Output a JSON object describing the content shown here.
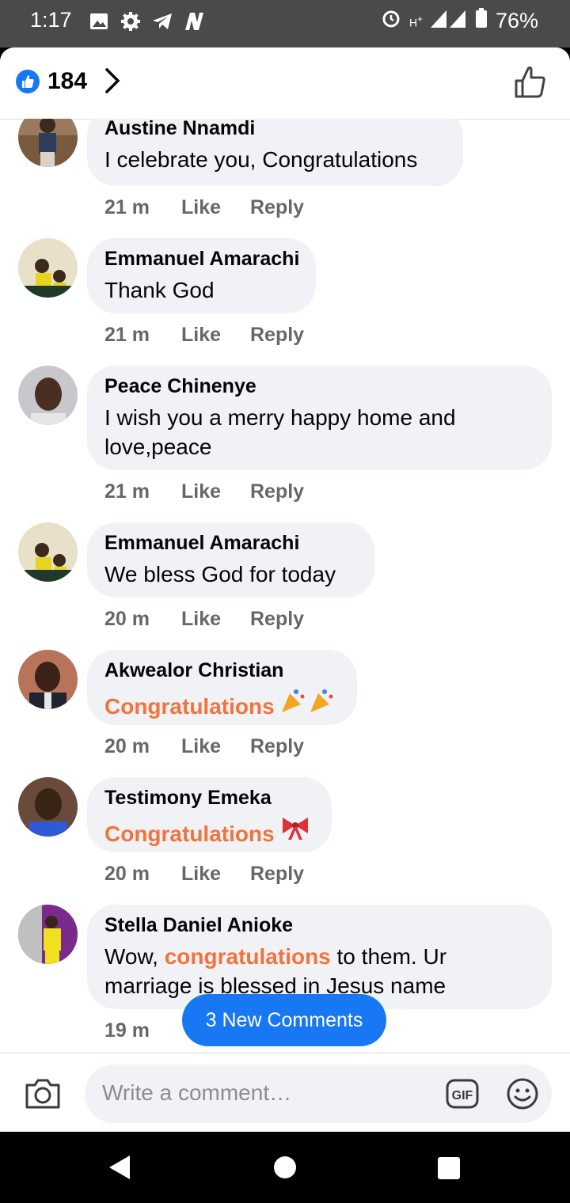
{
  "status_bar": {
    "time": "1:17",
    "battery": "76%"
  },
  "header": {
    "reaction_count": "184"
  },
  "comments": [
    {
      "author": "Austine Nnamdi",
      "lines": [
        "I celebrate you, Congratulations"
      ],
      "time": "21 m",
      "like": "Like",
      "reply": "Reply"
    },
    {
      "author": "Emmanuel Amarachi",
      "lines": [
        "Thank God"
      ],
      "time": "21 m",
      "like": "Like",
      "reply": "Reply"
    },
    {
      "author": "Peace Chinenye",
      "lines": [
        "I wish you a merry happy home and",
        "love,peace"
      ],
      "time": "21 m",
      "like": "Like",
      "reply": "Reply"
    },
    {
      "author": "Emmanuel Amarachi",
      "lines": [
        "We bless God for today"
      ],
      "time": "20 m",
      "like": "Like",
      "reply": "Reply"
    },
    {
      "author": "Akwealor Christian",
      "highlight": "Congratulations",
      "time": "20 m",
      "like": "Like",
      "reply": "Reply"
    },
    {
      "author": "Testimony Emeka",
      "highlight": "Congratulations",
      "time": "20 m",
      "like": "Like",
      "reply": "Reply"
    },
    {
      "author": "Stella Daniel Anioke",
      "prefix": "Wow, ",
      "highlight": "congratulations",
      "suffix": " to them. Ur",
      "line2": "marriage is blessed in Jesus name",
      "time": "19 m"
    }
  ],
  "new_comments_pill": "3 New Comments",
  "composer": {
    "placeholder": "Write a comment…",
    "gif_label": "GIF"
  },
  "colors": {
    "brand_blue": "#1877f2",
    "highlight_orange": "#f2733d",
    "bubble_bg": "#f0f2f5"
  }
}
